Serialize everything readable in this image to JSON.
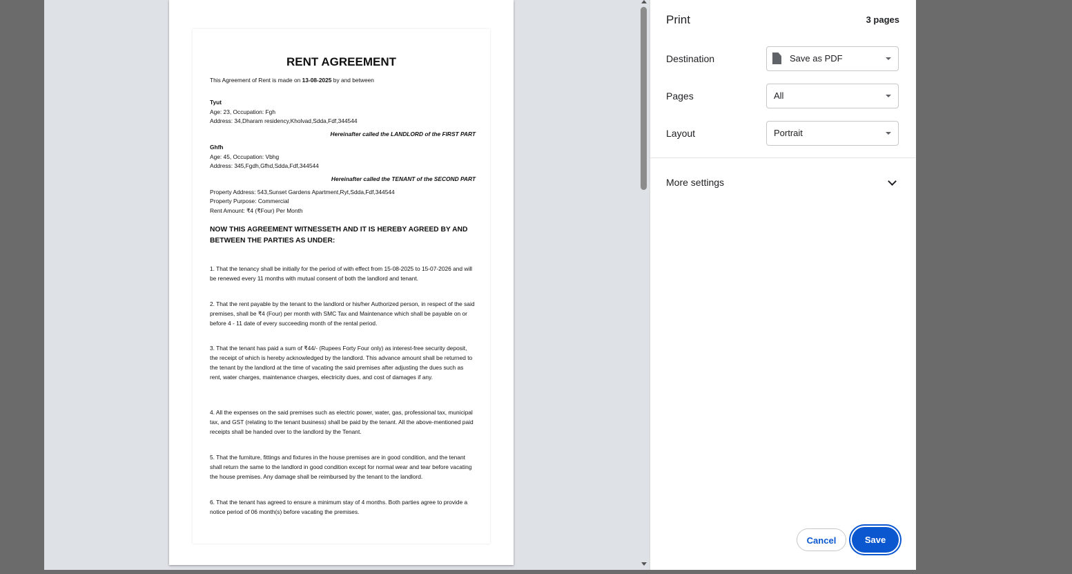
{
  "document": {
    "title": "RENT AGREEMENT",
    "intro_prefix": "This Agreement of Rent is made on ",
    "intro_date": "13-08-2025",
    "intro_suffix": " by and between",
    "landlord": {
      "name": "Tyut",
      "details": "Age: 23, Occupation: Fgh",
      "address": "Address: 34,Dharam residency,Kholvad,Sdda,Fdf,344544",
      "label": "Hereinafter called the LANDLORD of the FIRST PART"
    },
    "tenant": {
      "name": "Ghfh",
      "details": "Age: 45, Occupation: Vbhg",
      "address": "Address: 345,Fgdh,Gfhd,Sdda,Fdf,344544",
      "label": "Hereinafter called the TENANT of the SECOND PART"
    },
    "property_address": "Property Address: 543,Sunset Gardens Apartment,Ryt,Sdda,Fdf,344544",
    "property_purpose": "Property Purpose: Commercial",
    "rent_amount": "Rent Amount: ₹4 (₹Four) Per Month",
    "heading": "NOW THIS AGREEMENT WITNESSETH AND IT IS HEREBY AGREED BY AND BETWEEN THE PARTIES AS UNDER:",
    "clauses": [
      "1. That the tenancy shall be initially for the period of with effect from 15-08-2025 to 15-07-2026 and will be renewed every 11 months with mutual consent of both the landlord and tenant.",
      "2. That the rent payable by the tenant to the landlord or his/her Authorized person, in respect of the said premises, shall be ₹4 (Four) per month with SMC Tax and Maintenance which shall be payable on or before 4 - 11 date of every succeeding month of the rental period.",
      "3. That the tenant has paid a sum of ₹44/- (Rupees Forty Four only) as interest-free security deposit, the receipt of which is hereby acknowledged by the landlord. This advance amount shall be returned to the tenant by the landlord at the time of vacating the said premises after adjusting the dues such as rent, water charges, maintenance charges, electricity dues, and cost of damages if any.",
      "4. All the expenses on the said premises such as electric power, water, gas, professional tax, municipal tax, and GST (relating to the tenant business) shall be paid by the tenant. All the above-mentioned paid receipts shall be handed over to the landlord by the Tenant.",
      "5. That the furniture, fittings and fixtures in the house premises are in good condition, and the tenant shall return the same to the landlord in good condition except for normal wear and tear before vacating the house premises. Any damage shall be reimbursed by the tenant to the landlord.",
      "6. That the tenant has agreed to ensure a minimum stay of 4 months. Both parties agree to provide a notice period of 06 month(s) before vacating the premises."
    ]
  },
  "print_panel": {
    "title": "Print",
    "page_count": "3 pages",
    "destination_label": "Destination",
    "destination_value": "Save as PDF",
    "pages_label": "Pages",
    "pages_value": "All",
    "layout_label": "Layout",
    "layout_value": "Portrait",
    "more_settings": "More settings",
    "cancel": "Cancel",
    "save": "Save"
  },
  "colors": {
    "accent": "#0b57d0",
    "backdrop": "#6b6b6b",
    "preview_bg": "#dee1e6"
  }
}
